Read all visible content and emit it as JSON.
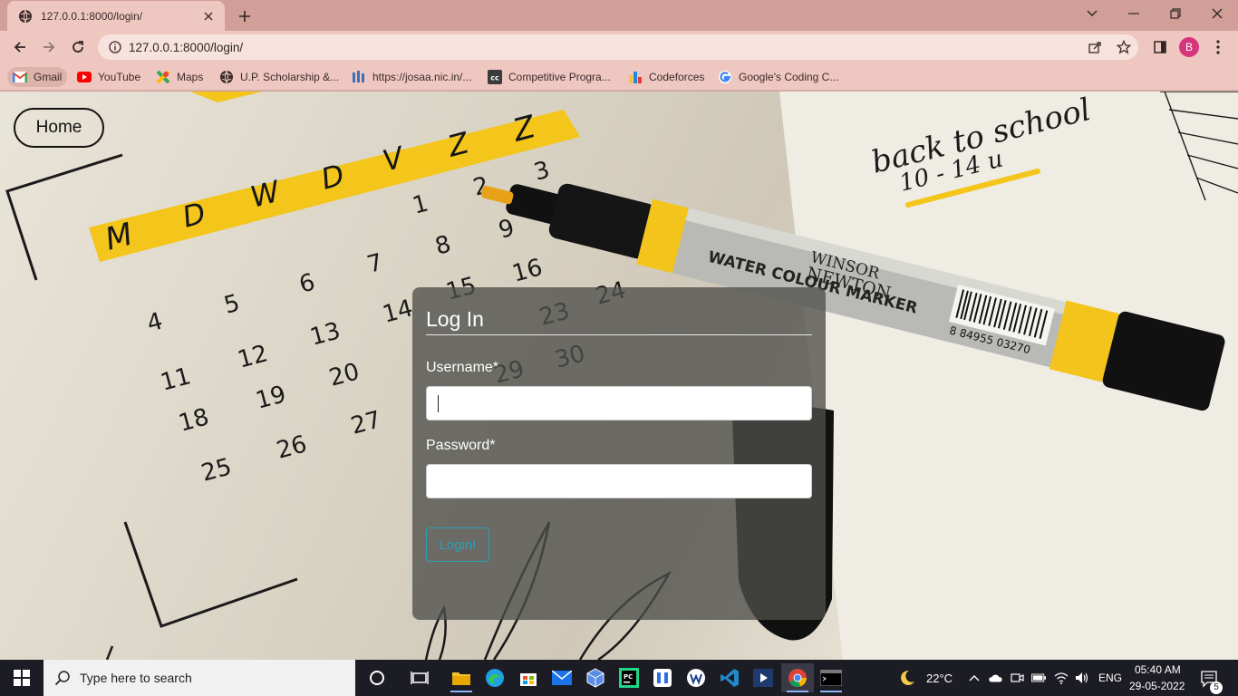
{
  "browser": {
    "tab_title": "127.0.0.1:8000/login/",
    "url": "127.0.0.1:8000/login/",
    "profile_initial": "B",
    "bookmarks": [
      {
        "label": "Gmail",
        "icon": "gmail-icon"
      },
      {
        "label": "YouTube",
        "icon": "youtube-icon"
      },
      {
        "label": "Maps",
        "icon": "maps-icon"
      },
      {
        "label": "U.P. Scholarship &...",
        "icon": "globe-icon"
      },
      {
        "label": "https://josaa.nic.in/...",
        "icon": "nic-icon"
      },
      {
        "label": "Competitive Progra...",
        "icon": "cc-icon"
      },
      {
        "label": "Codeforces",
        "icon": "codeforces-icon"
      },
      {
        "label": "Google's Coding C...",
        "icon": "google-icon"
      }
    ]
  },
  "page": {
    "home_label": "Home",
    "login": {
      "title": "Log In",
      "username_label": "Username*",
      "username_value": "",
      "password_label": "Password*",
      "password_value": "",
      "submit_label": "Login!"
    },
    "background_text": {
      "weekdays": [
        "M",
        "D",
        "W",
        "D",
        "V",
        "Z",
        "Z"
      ],
      "marker_label": "WATER COLOUR MARKER",
      "marker_brand_1": "WINSOR",
      "marker_brand_2": "NEWTON",
      "marker_barcode": "8 84955 03270",
      "note": "back to school",
      "note_sub": "10 - 14 u"
    }
  },
  "taskbar": {
    "search_placeholder": "Type here to search",
    "weather": "22°C",
    "language": "ENG",
    "time": "05:40 AM",
    "date": "29-05-2022",
    "notification_count": "5"
  },
  "colors": {
    "tabbar": "#d19f98",
    "toolbar": "#efc7c1",
    "card": "#4e4e4a",
    "login_button": "#2aa0b5",
    "taskbar": "#1c1c24"
  }
}
